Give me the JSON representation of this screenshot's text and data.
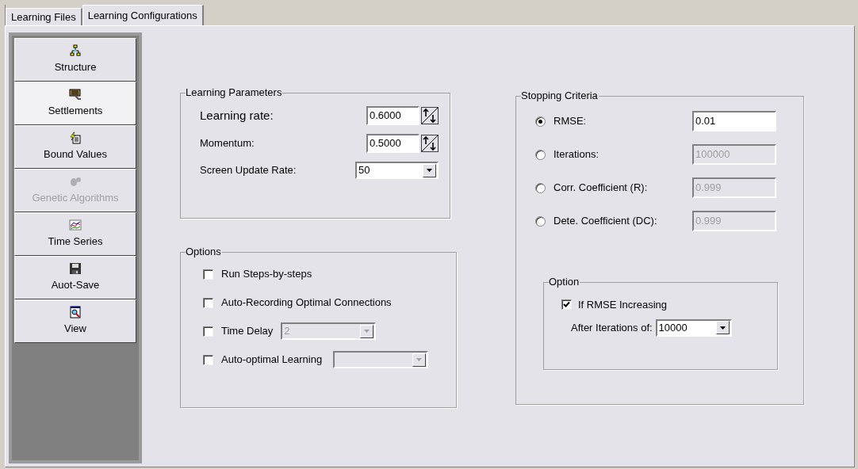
{
  "tabs": [
    {
      "label": "Learning Files",
      "selected": false
    },
    {
      "label": "Learning Configurations",
      "selected": true
    }
  ],
  "sidebar": {
    "items": [
      {
        "label": "Structure",
        "selected": false,
        "disabled": false
      },
      {
        "label": "Settlements",
        "selected": true,
        "disabled": false
      },
      {
        "label": "Bound Values",
        "selected": false,
        "disabled": false
      },
      {
        "label": "Genetic Algorithms",
        "selected": false,
        "disabled": true
      },
      {
        "label": "Time Series",
        "selected": false,
        "disabled": false
      },
      {
        "label": "Auot-Save",
        "selected": false,
        "disabled": false
      },
      {
        "label": "View",
        "selected": false,
        "disabled": false
      }
    ]
  },
  "learning_parameters": {
    "title": "Learning Parameters",
    "fields": [
      {
        "label": "Learning rate:",
        "value": "0.6000",
        "kind": "spinner"
      },
      {
        "label": "Momentum:",
        "value": "0.5000",
        "kind": "spinner"
      },
      {
        "label": "Screen Update Rate:",
        "value": "50",
        "kind": "dropdown"
      }
    ]
  },
  "options": {
    "title": "Options",
    "items": [
      {
        "label": "Run Steps-by-steps",
        "checked": false,
        "kind": "checkbox"
      },
      {
        "label": "Auto-Recording Optimal Connections",
        "checked": false,
        "kind": "checkbox"
      },
      {
        "label": "Time Delay",
        "checked": false,
        "kind": "checkbox_dropdown",
        "value": "2"
      },
      {
        "label": "Auto-optimal Learning",
        "checked": false,
        "kind": "checkbox_dropdown"
      }
    ]
  },
  "stopping_criteria": {
    "title": "Stopping Criteria",
    "criteria": [
      {
        "label": "RMSE:",
        "value": "0.01",
        "selected": true
      },
      {
        "label": "Iterations:",
        "value": "100000",
        "selected": false
      },
      {
        "label": "Corr. Coefficient (R):",
        "value": "0.999",
        "selected": false
      },
      {
        "label": "Dete. Coefficient (DC):",
        "value": "0.999",
        "selected": false
      }
    ],
    "option": {
      "title": "Option",
      "checkbox": {
        "label": "If RMSE Increasing",
        "checked": true
      },
      "dropdown": {
        "label": "After Iterations of:",
        "value": "10000"
      }
    }
  }
}
